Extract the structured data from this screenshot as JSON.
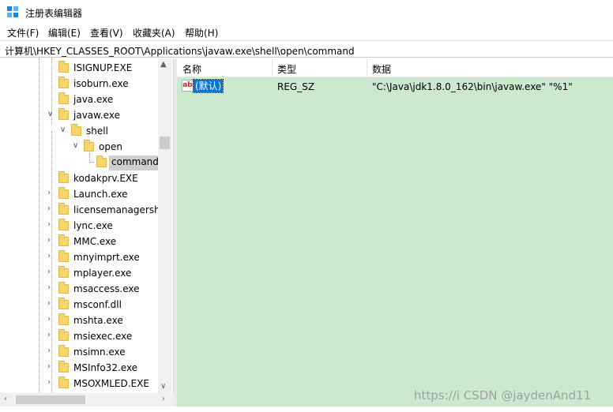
{
  "window": {
    "title": "注册表编辑器"
  },
  "menu": [
    "文件(F)",
    "编辑(E)",
    "查看(V)",
    "收藏夹(A)",
    "帮助(H)"
  ],
  "address": "计算机\\HKEY_CLASSES_ROOT\\Applications\\javaw.exe\\shell\\open\\command",
  "tree": [
    {
      "label": "ISIGNUP.EXE",
      "depth": 0,
      "expander": "none"
    },
    {
      "label": "isoburn.exe",
      "depth": 0,
      "expander": "none"
    },
    {
      "label": "java.exe",
      "depth": 0,
      "expander": "none"
    },
    {
      "label": "javaw.exe",
      "depth": 0,
      "expander": "expanded"
    },
    {
      "label": "shell",
      "depth": 1,
      "expander": "expanded"
    },
    {
      "label": "open",
      "depth": 2,
      "expander": "expanded"
    },
    {
      "label": "command",
      "depth": 3,
      "expander": "none",
      "selected": true
    },
    {
      "label": "kodakprv.EXE",
      "depth": 0,
      "expander": "none"
    },
    {
      "label": "Launch.exe",
      "depth": 0,
      "expander": "collapsed"
    },
    {
      "label": "licensemanagershe",
      "depth": 0,
      "expander": "collapsed"
    },
    {
      "label": "lync.exe",
      "depth": 0,
      "expander": "collapsed"
    },
    {
      "label": "MMC.exe",
      "depth": 0,
      "expander": "collapsed"
    },
    {
      "label": "mnyimprt.exe",
      "depth": 0,
      "expander": "collapsed"
    },
    {
      "label": "mplayer.exe",
      "depth": 0,
      "expander": "collapsed"
    },
    {
      "label": "msaccess.exe",
      "depth": 0,
      "expander": "collapsed"
    },
    {
      "label": "msconf.dll",
      "depth": 0,
      "expander": "collapsed"
    },
    {
      "label": "mshta.exe",
      "depth": 0,
      "expander": "collapsed"
    },
    {
      "label": "msiexec.exe",
      "depth": 0,
      "expander": "collapsed"
    },
    {
      "label": "msimn.exe",
      "depth": 0,
      "expander": "collapsed"
    },
    {
      "label": "MSInfo32.exe",
      "depth": 0,
      "expander": "collapsed"
    },
    {
      "label": "MSOXMLED.EXE",
      "depth": 0,
      "expander": "collapsed"
    }
  ],
  "columns": {
    "name": "名称",
    "type": "类型",
    "data": "数据"
  },
  "values": [
    {
      "name": "(默认)",
      "type": "REG_SZ",
      "data": "\"C:\\Java\\jdk1.8.0_162\\bin\\javaw.exe\" \"%1\"",
      "icon": "ab"
    }
  ],
  "watermark": "https://i CSDN @jaydenAnd11",
  "colors": {
    "list_bg": "#cce8cf",
    "selection": "#0078d7",
    "folder": "#f7d66f"
  }
}
